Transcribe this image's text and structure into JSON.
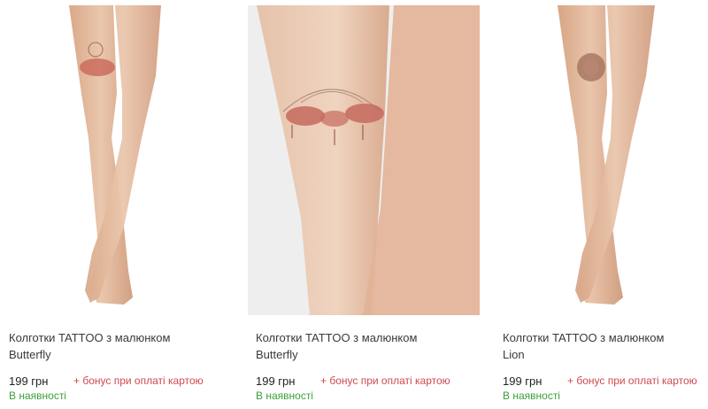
{
  "products": [
    {
      "title_line1": "Колготки TATTOO з малюнком",
      "title_line2": "Butterfly",
      "price": "199 грн",
      "bonus": "+ бонус при оплаті картою",
      "availability": "В наявності",
      "image_icon": "legs-tattoo-photo"
    },
    {
      "title_line1": "Колготки TATTOO з малюнком",
      "title_line2": "Butterfly",
      "price": "199 грн",
      "bonus": "+ бонус при оплаті картою",
      "availability": "В наявності",
      "image_icon": "thigh-tattoo-closeup-photo"
    },
    {
      "title_line1": "Колготки TATTOO з малюнком",
      "title_line2": "Lion",
      "price": "199 грн",
      "bonus": "+ бонус при оплаті картою",
      "availability": "В наявності",
      "image_icon": "legs-lion-tattoo-photo"
    }
  ],
  "colors": {
    "price_text": "#222222",
    "bonus_text": "#d0494f",
    "availability_text": "#3aa13a",
    "skin_tone": "#e3b99c"
  }
}
